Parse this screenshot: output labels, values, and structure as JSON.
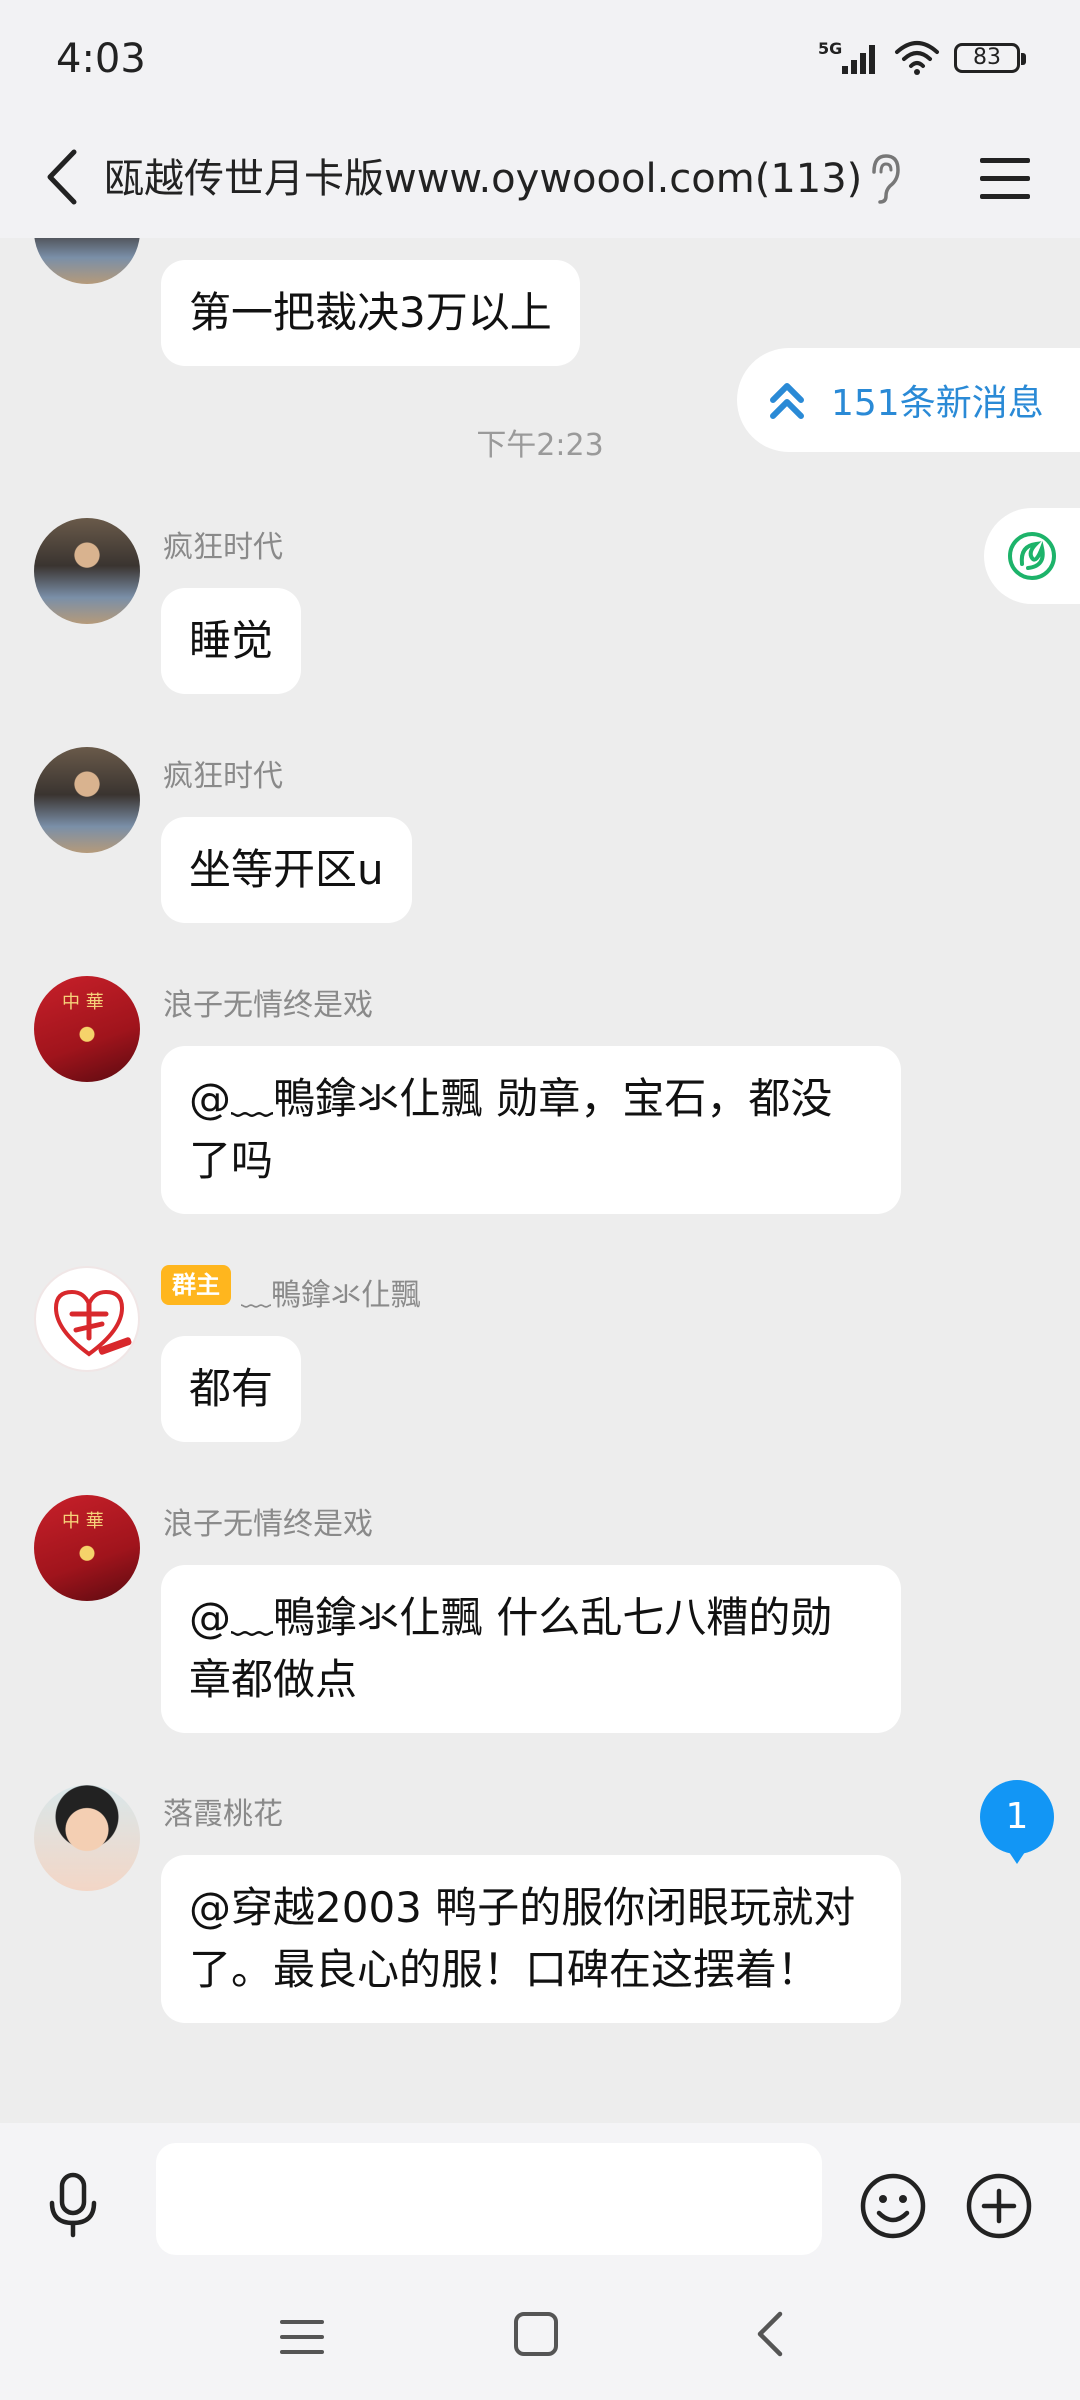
{
  "status_bar": {
    "time": "4:03",
    "network": "5G",
    "battery": "83"
  },
  "header": {
    "title": "瓯越传世月卡版www.oywoool.com(113)",
    "back_icon": "chevron-left-icon",
    "ear_icon": "ear-icon",
    "menu_icon": "hamburger-menu-icon"
  },
  "chat": {
    "new_messages_label": "151条新消息",
    "unread_count": "1",
    "timestamp": "下午2:23",
    "top_partial_message": "第一把裁决3万以上",
    "messages": [
      {
        "sender": "疯狂时代",
        "text": "睡觉"
      },
      {
        "sender": "疯狂时代",
        "text": "坐等开区u"
      },
      {
        "sender": "浪子无情终是戏",
        "text": "@﹏鴨鎿氺仩飄 勋章，宝石，都没了吗"
      },
      {
        "sender": "﹏鴨鎿氺仩飄",
        "badge": "群主",
        "text": "都有"
      },
      {
        "sender": "浪子无情终是戏",
        "text": "@﹏鴨鎿氺仩飄 什么乱七八糟的勋章都做点"
      },
      {
        "sender": "落霞桃花",
        "text": "@穿越2003 鸭子的服你闭眼玩就对了。最良心的服！口碑在这摆着！"
      }
    ]
  },
  "input_bar": {
    "placeholder": "",
    "value": ""
  },
  "colors": {
    "accent": "#1296f5",
    "link_blue": "#2a8ad6",
    "badge_orange": "#ffb61e",
    "chat_bg": "#ededed",
    "bubble_bg": "#ffffff"
  }
}
